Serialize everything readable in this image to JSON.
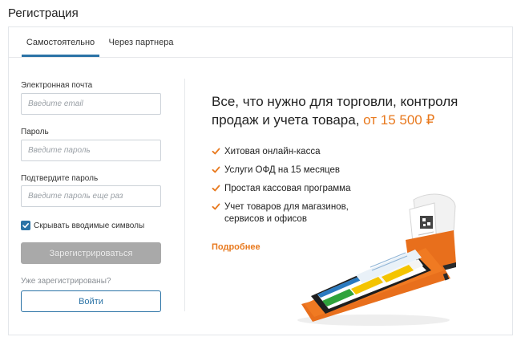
{
  "page": {
    "title": "Регистрация"
  },
  "tabs": [
    {
      "label": "Самостоятельно",
      "active": true
    },
    {
      "label": "Через партнера",
      "active": false
    }
  ],
  "form": {
    "email": {
      "label": "Электронная почта",
      "placeholder": "Введите email",
      "value": ""
    },
    "password": {
      "label": "Пароль",
      "placeholder": "Введите пароль",
      "value": ""
    },
    "confirm": {
      "label": "Подтвердите пароль",
      "placeholder": "Введите пароль еще раз",
      "value": ""
    },
    "hide_symbols": {
      "label": "Скрывать вводимые символы",
      "checked": true
    },
    "register_label": "Зарегистрироваться",
    "already_registered": "Уже зарегистрированы?",
    "login_label": "Войти"
  },
  "promo": {
    "title": "Все, что нужно для торговли, контроля продаж и учета товара,",
    "price": "от 15 500 ₽",
    "features": [
      "Хитовая онлайн-касса",
      "Услуги ОФД на 15 месяцев",
      "Простая кассовая программа",
      "Учет товаров для магазинов, сервисов и офисов"
    ],
    "more_link": "Подробнее"
  },
  "colors": {
    "accent": "#2b73a6",
    "promo_orange": "#e8791e",
    "register_disabled": "#a9a9a9"
  },
  "icons": {
    "checkbox": "checkmark-icon",
    "feature_bullet": "orange-checkmark-icon",
    "device_image": "pos-terminal-illustration"
  }
}
